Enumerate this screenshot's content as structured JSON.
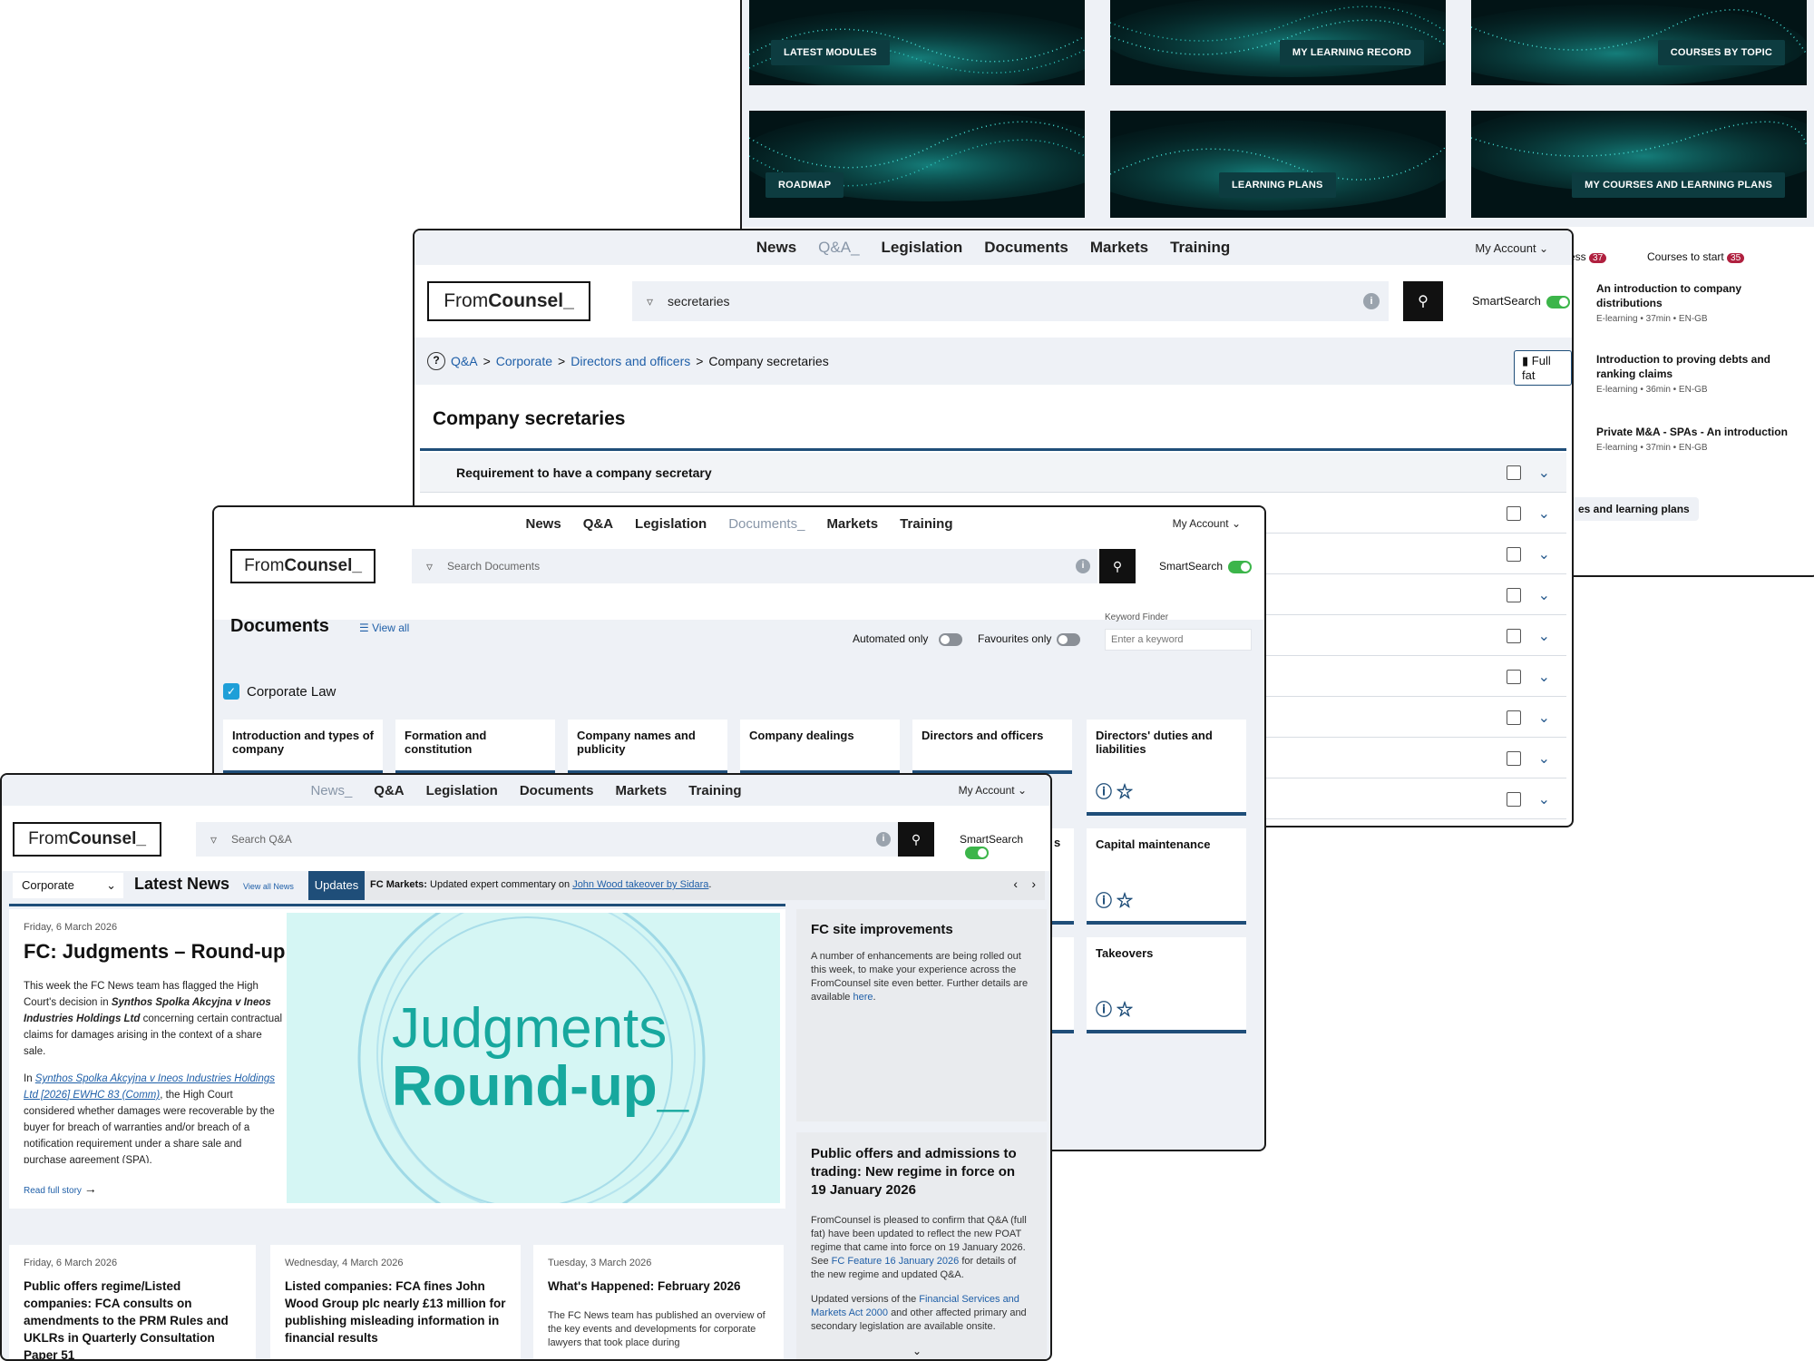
{
  "learning": {
    "tiles": [
      "LATEST MODULES",
      "MY LEARNING RECORD",
      "COURSES BY TOPIC",
      "ROADMAP",
      "LEARNING PLANS",
      "MY COURSES AND LEARNING PLANS"
    ],
    "tab_in_progress": "ess",
    "tab_in_progress_count": "37",
    "tab_courses_to_start": "Courses to start",
    "tab_courses_to_start_count": "35",
    "courses": [
      {
        "title": "An introduction to company distributions",
        "meta": "E-learning • 37min • EN-GB"
      },
      {
        "title": "Introduction to proving debts and ranking claims",
        "meta": "E-learning • 36min • EN-GB"
      },
      {
        "title": "Private M&A - SPAs - An introduction",
        "meta": "E-learning • 37min • EN-GB"
      }
    ],
    "plans_button": "es and learning plans"
  },
  "qa": {
    "nav": [
      "News",
      "Q&A_",
      "Legislation",
      "Documents",
      "Markets",
      "Training"
    ],
    "my_account": "My Account",
    "logo_from": "From",
    "logo_counsel": "Counsel_",
    "search_value": "secretaries",
    "smartsearch": "SmartSearch",
    "breadcrumb": [
      "Q&A",
      "Corporate",
      "Directors and officers",
      "Company secretaries"
    ],
    "full_fat": "Full fat",
    "title": "Company secretaries",
    "first_row": "Requirement to have a company secretary"
  },
  "docs": {
    "nav": [
      "News",
      "Q&A",
      "Legislation",
      "Documents_",
      "Markets",
      "Training"
    ],
    "my_account": "My Account",
    "logo_from": "From",
    "logo_counsel": "Counsel_",
    "search_placeholder": "Search Documents",
    "smartsearch": "SmartSearch",
    "title": "Documents",
    "view_all": "View all",
    "automated_only": "Automated only",
    "favourites_only": "Favourites only",
    "keyword_label": "Keyword Finder",
    "keyword_placeholder": "Enter a keyword",
    "category": "Corporate Law",
    "cards": [
      "Introduction and types of company",
      "Formation and constitution",
      "Company names and publicity",
      "Company dealings",
      "Directors and officers",
      "Directors' duties and liabilities"
    ],
    "cards_col6": [
      "Capital maintenance",
      "Takeovers"
    ],
    "cut_card_tail": "s"
  },
  "news": {
    "nav": [
      "News_",
      "Q&A",
      "Legislation",
      "Documents",
      "Markets",
      "Training"
    ],
    "my_account": "My Account",
    "logo_from": "From",
    "logo_counsel": "Counsel_",
    "search_placeholder": "Search Q&A",
    "smartsearch": "SmartSearch",
    "dropdown": "Corporate",
    "latest_news": "Latest News",
    "view_all": "View all News",
    "updates_badge": "Updates",
    "ticker_label": "FC Markets:",
    "ticker_text": "Updated expert commentary on",
    "ticker_link": "John Wood takeover by Sidara",
    "ticker_end": ".",
    "hero": {
      "date": "Friday, 6 March 2026",
      "title": "FC: Judgments – Round-up",
      "p1_a": "This week the FC News team has flagged the High Court's decision in",
      "p1_case": "Synthos Spolka Akcyjna v Ineos Industries Holdings Ltd",
      "p1_b": "concerning certain contractual claims for damages arising in the context of a share sale.",
      "p2_in": "In",
      "p2_link": "Synthos Spolka Akcyjna v Ineos Industries Holdings Ltd [2026] EWHC 83 (Comm)",
      "p2_b": ", the High Court considered whether damages were recoverable by the buyer for breach of warranties and/or breach of a notification requirement under a share sale and purchase agreement (SPA).",
      "read_more": "Read full story",
      "image_line1": "Judgments",
      "image_line2": "Round-up_"
    },
    "site_improvements": {
      "title": "FC site improvements",
      "text": "A number of enhancements are being rolled out this week, to make your experience across the FromCounsel site even better. Further details are available",
      "link": "here",
      "end": "."
    },
    "public_offers": {
      "title": "Public offers and admissions to trading: New regime in force on 19 January 2026",
      "p1_a": "FromCounsel is pleased to confirm that Q&A (full fat) have been updated to reflect the new POAT regime that came into force on 19 January 2026. See",
      "p1_link": "FC Feature 16 January 2026",
      "p1_b": "for details of the new regime and updated Q&A.",
      "p2_a": "Updated versions of the",
      "p2_link": "Financial Services and Markets Act 2000",
      "p2_b": "and other affected primary and secondary legislation are available onsite."
    },
    "cards": [
      {
        "date": "Friday, 6 March 2026",
        "title": "Public offers regime/Listed companies: FCA consults on amendments to the PRM Rules and UKLRs in Quarterly Consultation Paper 51",
        "text": ""
      },
      {
        "date": "Wednesday, 4 March 2026",
        "title": "Listed companies: FCA fines John Wood Group plc nearly £13 million for publishing misleading information in financial results",
        "text": ""
      },
      {
        "date": "Tuesday, 3 March 2026",
        "title": "What's Happened: February 2026",
        "text": "The FC News team has published an overview of the key events and developments for corporate lawyers that took place during"
      }
    ]
  },
  "colors": {
    "accent": "#1f4e79",
    "teal": "#17a89e",
    "toggle_on": "#3cb54a",
    "link": "#1f5fa8"
  }
}
